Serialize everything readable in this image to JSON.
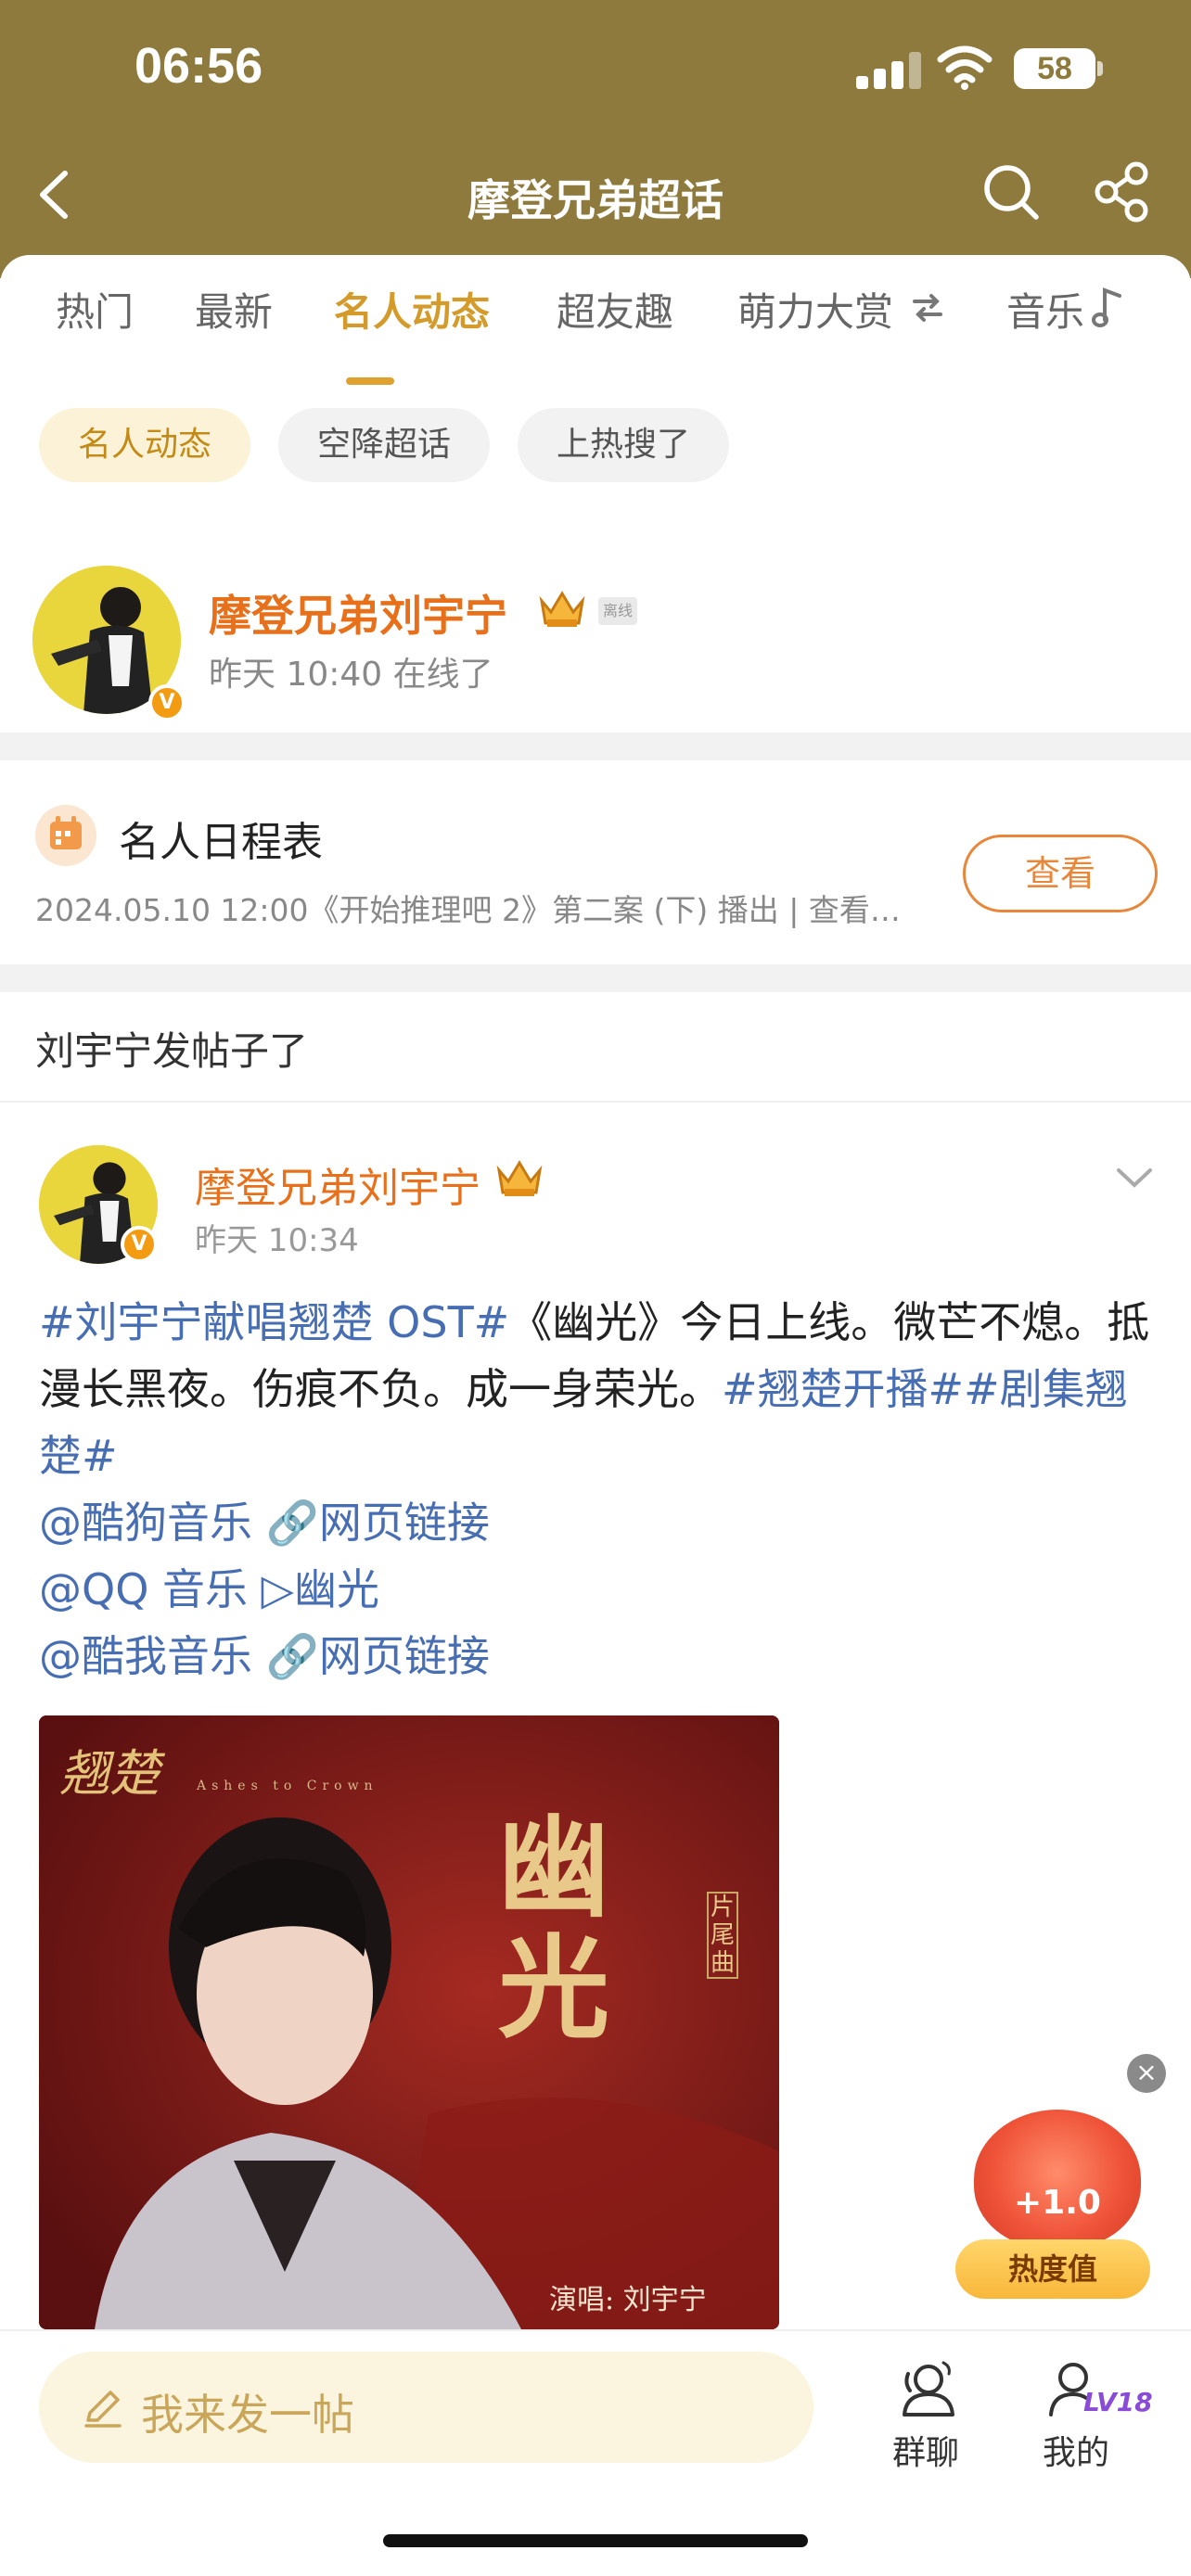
{
  "status_bar": {
    "time": "06:56",
    "battery": "58"
  },
  "header": {
    "title": "摩登兄弟超话"
  },
  "tabs": [
    {
      "label": "热门"
    },
    {
      "label": "最新"
    },
    {
      "label": "名人动态"
    },
    {
      "label": "超友趣"
    },
    {
      "label": "萌力大赏"
    },
    {
      "label": "音乐"
    }
  ],
  "active_tab": "名人动态",
  "chips": [
    {
      "label": "名人动态"
    },
    {
      "label": "空降超话"
    },
    {
      "label": "上热搜了"
    }
  ],
  "profile": {
    "name": "摩登兄弟刘宇宁",
    "offline_tag": "离线",
    "status": "昨天 10:40 在线了"
  },
  "schedule": {
    "title": "名人日程表",
    "line": "2024.05.10 12:00《开始推理吧 2》第二案 (下) 播出 |   查看…",
    "button": "查看"
  },
  "section_title": "刘宇宁发帖子了",
  "post": {
    "author": "摩登兄弟刘宇宁",
    "time": "昨天 10:34",
    "tag1": "#刘宇宁献唱翘楚 OST#",
    "text1": "《幽光》今日上线。微芒不熄。抵漫长黑夜。伤痕不负。成一身荣光。",
    "tag2": "#翘楚开播##剧集翘楚#",
    "link1": "@酷狗音乐 🔗网页链接",
    "link2": "@QQ 音乐 ▷幽光",
    "link3": "@酷我音乐 🔗网页链接",
    "image_text": {
      "show_logo": "翘楚",
      "show_subtitle": "Ashes to Crown",
      "song_title": "幽光",
      "song_tag": "片尾曲",
      "singer": "演唱: 刘宇宁"
    }
  },
  "heat_widget": {
    "plus": "+1.0",
    "label": "热度值"
  },
  "bottom_bar": {
    "compose_placeholder": "我来发一帖",
    "group_chat": "群聊",
    "me": "我的",
    "level": "LV18"
  }
}
